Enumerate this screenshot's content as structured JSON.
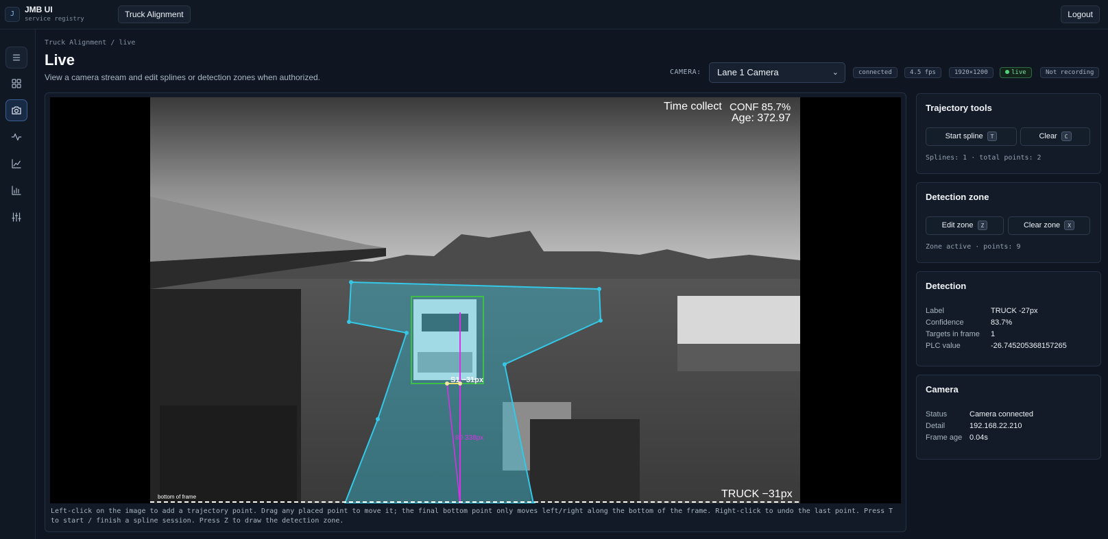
{
  "app": {
    "badge": "J",
    "title": "JMB UI",
    "subtitle": "service registry"
  },
  "topbar": {
    "nav_label": "Truck Alignment",
    "logout_label": "Logout"
  },
  "rail": {
    "items": [
      "menu-icon",
      "grid-icon",
      "camera-icon",
      "pulse-icon",
      "line-chart-icon",
      "bar-chart-icon",
      "sliders-icon"
    ],
    "active": "camera-icon"
  },
  "header": {
    "breadcrumb": "Truck Alignment / live",
    "title": "Live",
    "subtitle": "View a camera stream and edit splines or detection zones when authorized."
  },
  "camera_bar": {
    "label": "CAMERA:",
    "selected": "Lane 1 Camera",
    "pills": {
      "status": "connected",
      "fps": "4.5 fps",
      "resolution": "1920×1200",
      "live": "live",
      "recording": "Not recording"
    }
  },
  "overlay": {
    "time_collect": "Time collect",
    "conf": "CONF 85.7%",
    "age": "Age: 372.97",
    "spline_label": "S1 −31px",
    "distance_label": "80 338px",
    "bottom_of_frame": "bottom of frame",
    "truck_offset": "TRUCK −31px",
    "zone_color": "#35c8e6",
    "spline_color": "#d633e6",
    "box_color": "#3fbf4a"
  },
  "help_text": "Left-click on the image to add a trajectory point. Drag any placed point to move it; the final bottom point only moves left/right along the bottom of the frame. Right-click to undo the last point. Press T to start / finish a spline session. Press Z to draw the detection zone.",
  "trajectory": {
    "title": "Trajectory tools",
    "start_label": "Start spline",
    "start_key": "T",
    "clear_label": "Clear",
    "clear_key": "C",
    "summary": "Splines: 1 · total points: 2"
  },
  "zone": {
    "title": "Detection zone",
    "edit_label": "Edit zone",
    "edit_key": "Z",
    "clear_label": "Clear zone",
    "clear_key": "X",
    "summary": "Zone active · points: 9"
  },
  "detection": {
    "title": "Detection",
    "rows": [
      {
        "k": "Label",
        "v": "TRUCK -27px"
      },
      {
        "k": "Confidence",
        "v": "83.7%"
      },
      {
        "k": "Targets in frame",
        "v": "1"
      },
      {
        "k": "PLC value",
        "v": "-26.745205368157265"
      }
    ]
  },
  "camera": {
    "title": "Camera",
    "rows": [
      {
        "k": "Status",
        "v": "Camera connected"
      },
      {
        "k": "Detail",
        "v": "192.168.22.210"
      },
      {
        "k": "Frame age",
        "v": "0.04s"
      }
    ]
  }
}
